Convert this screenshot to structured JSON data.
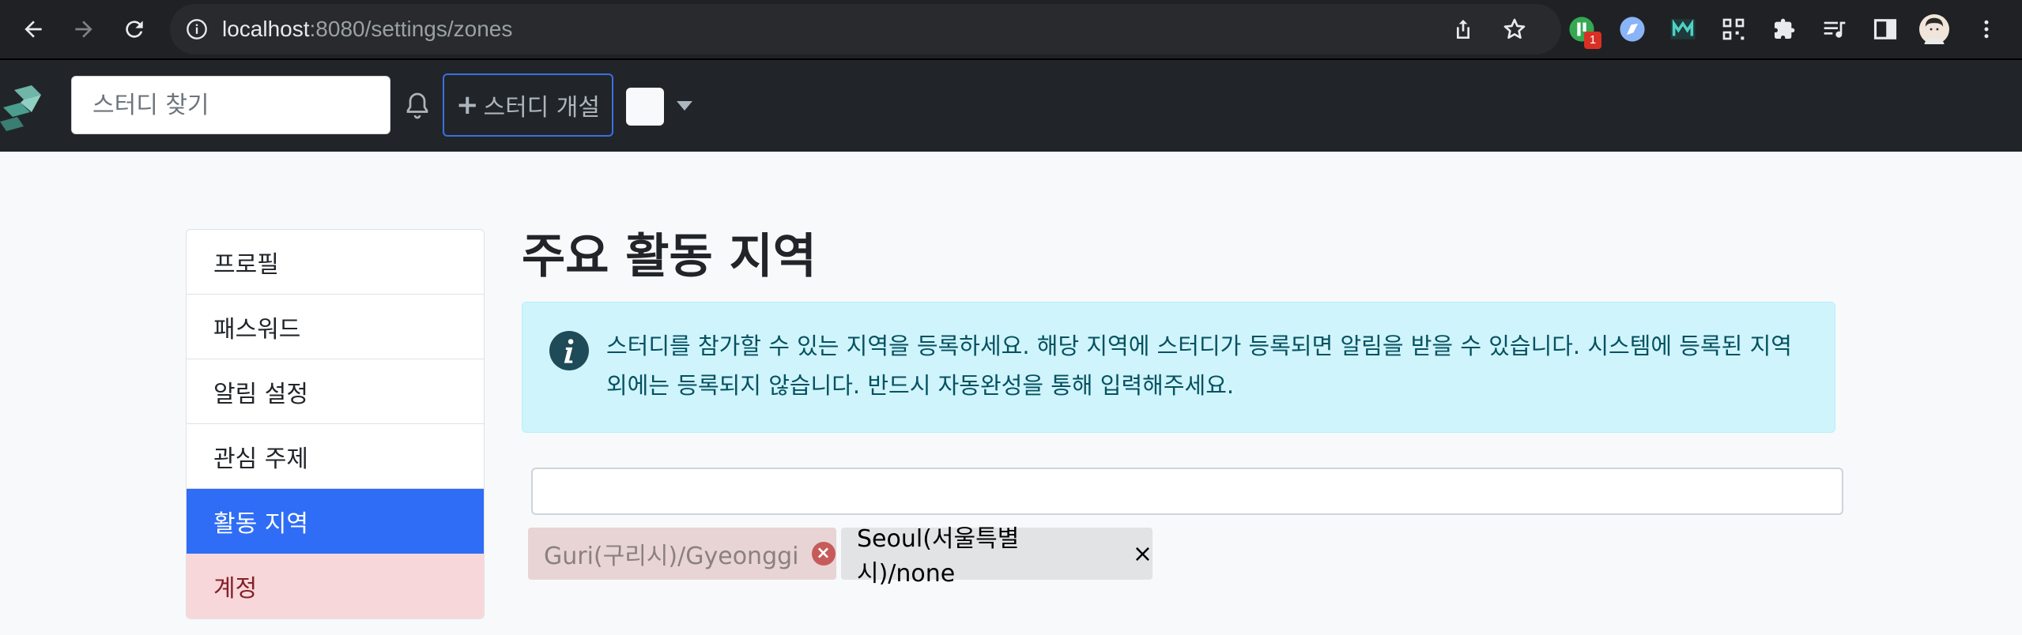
{
  "browser": {
    "url_host": "localhost",
    "url_path": ":8080/settings/zones",
    "extension_badge": "1"
  },
  "navbar": {
    "search_placeholder": "스터디 찾기",
    "create_button_label": "스터디 개설",
    "create_button_icon": "+"
  },
  "sidebar": {
    "items": [
      {
        "label": "프로필"
      },
      {
        "label": "패스워드"
      },
      {
        "label": "알림 설정"
      },
      {
        "label": "관심 주제"
      },
      {
        "label": "활동 지역"
      },
      {
        "label": "계정"
      }
    ]
  },
  "main": {
    "title": "주요 활동 지역",
    "info_message": "스터디를 참가할 수 있는 지역을 등록하세요. 해당 지역에 스터디가 등록되면 알림을 받을 수 있습니다. 시스템에 등록된 지역 외에는 등록되지 않습니다. 반드시 자동완성을 통해 입력해주세요.",
    "tags": [
      {
        "label": "Guri(구리시)/Gyeonggi",
        "remove": "×"
      },
      {
        "label": "Seoul(서울특별시)/none",
        "remove": "×"
      }
    ]
  },
  "colors": {
    "primary": "#2f6df6",
    "navbar_bg": "#212529",
    "alert_bg": "#cff4fc",
    "danger_bg": "#f8d7da"
  }
}
